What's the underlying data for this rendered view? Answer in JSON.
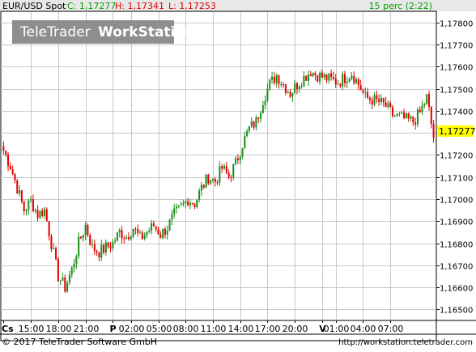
{
  "header": {
    "instrument": "EUR/USD Spot",
    "close_label": "C: 1,17277",
    "high_label": "H: 1,17341",
    "low_label": "L: 1,17253",
    "interval": "15 perc (2:22)"
  },
  "watermark": {
    "light": "TeleTrader",
    "bold": "WorkStation"
  },
  "last_price_label": "1,17277",
  "footer": {
    "copyright": "© 2017 TeleTrader Software GmbH",
    "url": "http://workstation.teletrader.com"
  },
  "colors": {
    "up": "#1a8f1a",
    "down": "#e60000",
    "grid": "#c8c8c8",
    "header_bg": "#e8e8e8",
    "price_tag": "#ffff00",
    "watermark_bg": "#8e8e8e",
    "green_text": "#00a000",
    "red_text": "#e00000"
  },
  "chart_data": {
    "type": "candlestick",
    "ylim": [
      1.1645,
      1.1785
    ],
    "yticks": [
      {
        "v": 1.165,
        "label": "1,16500"
      },
      {
        "v": 1.166,
        "label": "1,16600"
      },
      {
        "v": 1.167,
        "label": "1,16700"
      },
      {
        "v": 1.168,
        "label": "1,16800"
      },
      {
        "v": 1.169,
        "label": "1,16900"
      },
      {
        "v": 1.17,
        "label": "1,17000"
      },
      {
        "v": 1.171,
        "label": "1,17100"
      },
      {
        "v": 1.172,
        "label": "1,17200"
      },
      {
        "v": 1.173,
        "label": "1,17300"
      },
      {
        "v": 1.174,
        "label": "1,17400"
      },
      {
        "v": 1.175,
        "label": "1,17500"
      },
      {
        "v": 1.176,
        "label": "1,17600"
      },
      {
        "v": 1.177,
        "label": "1,17700"
      },
      {
        "v": 1.178,
        "label": "1,17800"
      }
    ],
    "time_axis": [
      {
        "i": 0,
        "label": "Cs",
        "bold": true
      },
      {
        "i": 12,
        "label": "15:00",
        "bold": false
      },
      {
        "i": 24,
        "label": "18:00",
        "bold": false
      },
      {
        "i": 36,
        "label": "21:00",
        "bold": false
      },
      {
        "i": 48,
        "label": "P",
        "bold": true
      },
      {
        "i": 56,
        "label": "02:00",
        "bold": false
      },
      {
        "i": 68,
        "label": "05:00",
        "bold": false
      },
      {
        "i": 80,
        "label": "08:00",
        "bold": false
      },
      {
        "i": 92,
        "label": "11:00",
        "bold": false
      },
      {
        "i": 104,
        "label": "14:00",
        "bold": false
      },
      {
        "i": 116,
        "label": "17:00",
        "bold": false
      },
      {
        "i": 128,
        "label": "20:00",
        "bold": false
      },
      {
        "i": 140,
        "label": "V",
        "bold": true
      },
      {
        "i": 146,
        "label": "01:00",
        "bold": false
      },
      {
        "i": 158,
        "label": "04:00",
        "bold": false
      },
      {
        "i": 170,
        "label": "07:00",
        "bold": false
      }
    ],
    "last_price": 1.17277,
    "close_path": [
      [
        0,
        1.1722
      ],
      [
        3,
        1.1715
      ],
      [
        6,
        1.1705
      ],
      [
        9,
        1.1695
      ],
      [
        12,
        1.1699
      ],
      [
        15,
        1.1693
      ],
      [
        18,
        1.1695
      ],
      [
        21,
        1.168
      ],
      [
        24,
        1.1665
      ],
      [
        27,
        1.166
      ],
      [
        30,
        1.1668
      ],
      [
        33,
        1.168
      ],
      [
        36,
        1.1688
      ],
      [
        39,
        1.1678
      ],
      [
        42,
        1.1676
      ],
      [
        45,
        1.1678
      ],
      [
        48,
        1.168
      ],
      [
        51,
        1.1685
      ],
      [
        54,
        1.1683
      ],
      [
        57,
        1.1687
      ],
      [
        60,
        1.1682
      ],
      [
        63,
        1.1685
      ],
      [
        66,
        1.1688
      ],
      [
        69,
        1.1684
      ],
      [
        72,
        1.1687
      ],
      [
        75,
        1.1693
      ],
      [
        78,
        1.1696
      ],
      [
        81,
        1.17
      ],
      [
        84,
        1.1698
      ],
      [
        87,
        1.1705
      ],
      [
        90,
        1.171
      ],
      [
        93,
        1.1708
      ],
      [
        96,
        1.1714
      ],
      [
        99,
        1.171
      ],
      [
        102,
        1.1716
      ],
      [
        105,
        1.1725
      ],
      [
        108,
        1.1732
      ],
      [
        111,
        1.1735
      ],
      [
        114,
        1.1745
      ],
      [
        117,
        1.1752
      ],
      [
        120,
        1.1756
      ],
      [
        123,
        1.1752
      ],
      [
        126,
        1.1748
      ],
      [
        129,
        1.1752
      ],
      [
        132,
        1.1755
      ],
      [
        135,
        1.1758
      ],
      [
        138,
        1.1756
      ],
      [
        141,
        1.1755
      ],
      [
        144,
        1.1754
      ],
      [
        147,
        1.1753
      ],
      [
        150,
        1.1755
      ],
      [
        153,
        1.1757
      ],
      [
        156,
        1.1752
      ],
      [
        159,
        1.1746
      ],
      [
        162,
        1.1745
      ],
      [
        165,
        1.1744
      ],
      [
        168,
        1.1742
      ],
      [
        171,
        1.1738
      ],
      [
        174,
        1.1737
      ],
      [
        177,
        1.1736
      ],
      [
        180,
        1.1735
      ],
      [
        183,
        1.1739
      ],
      [
        186,
        1.1746
      ],
      [
        189,
        1.1728
      ]
    ],
    "n_candles": 190
  }
}
